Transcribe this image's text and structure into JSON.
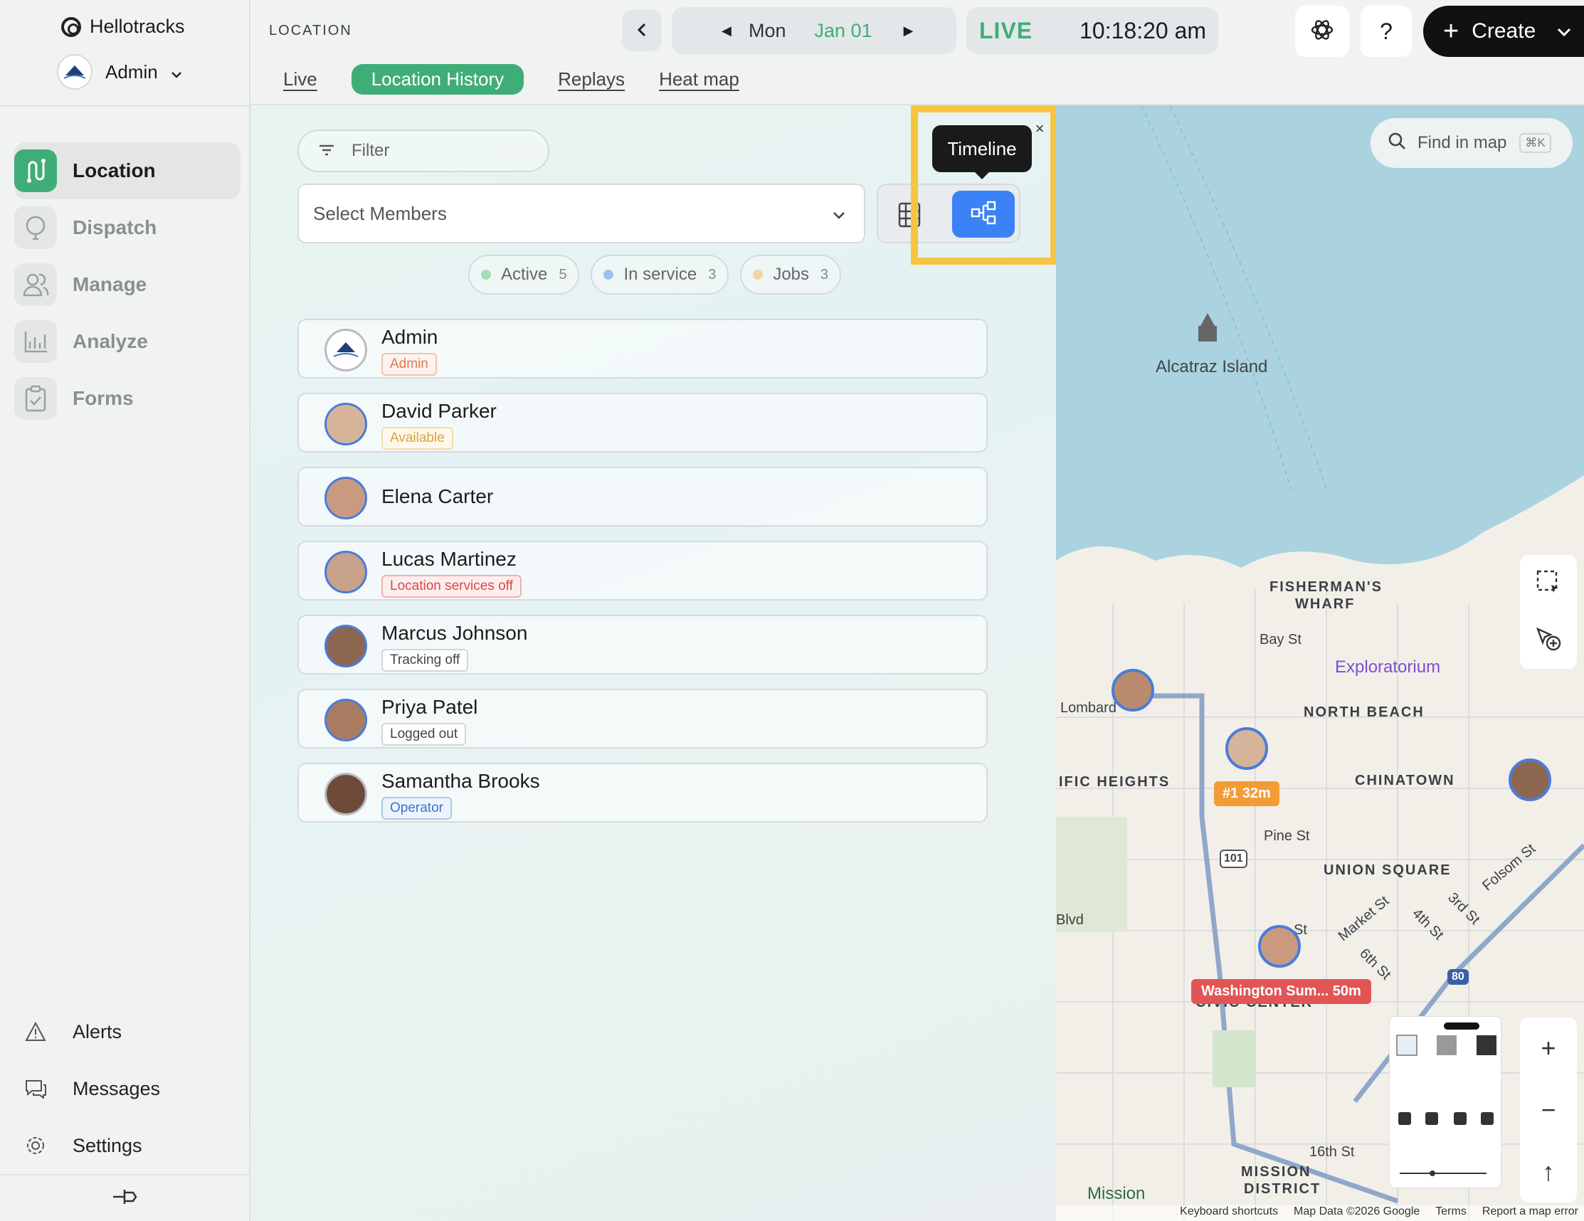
{
  "app": {
    "name": "Hellotracks",
    "account": "Admin"
  },
  "sidebar": {
    "items": [
      {
        "label": "Location",
        "active": true
      },
      {
        "label": "Dispatch"
      },
      {
        "label": "Manage"
      },
      {
        "label": "Analyze"
      },
      {
        "label": "Forms"
      }
    ],
    "bottom": [
      {
        "label": "Alerts"
      },
      {
        "label": "Messages"
      },
      {
        "label": "Settings"
      }
    ]
  },
  "header": {
    "page_label": "LOCATION",
    "date": {
      "day": "Mon",
      "date": "Jan 01"
    },
    "live_label": "LIVE",
    "time": "10:18:20 am",
    "help": "?",
    "create": "Create",
    "tabs": [
      {
        "label": "Live"
      },
      {
        "label": "Location History",
        "active": true
      },
      {
        "label": "Replays"
      },
      {
        "label": "Heat map"
      }
    ]
  },
  "panel": {
    "filter_placeholder": "Filter",
    "select_placeholder": "Select Members",
    "tooltip": "Timeline",
    "chips": [
      {
        "label": "Active",
        "count": "5",
        "color": "#a8dcb6"
      },
      {
        "label": "In service",
        "count": "3",
        "color": "#9cc2f0"
      },
      {
        "label": "Jobs",
        "count": "3",
        "color": "#f2d49e"
      }
    ],
    "members": [
      {
        "name": "Admin",
        "tag": "Admin",
        "tag_color": "#e07a4f"
      },
      {
        "name": "David Parker",
        "tag": "Available",
        "tag_color": "#e0a23a"
      },
      {
        "name": "Elena Carter",
        "tag": ""
      },
      {
        "name": "Lucas Martinez",
        "tag": "Location services off",
        "tag_color": "#d94848"
      },
      {
        "name": "Marcus Johnson",
        "tag": "Tracking off",
        "tag_color": "#444444"
      },
      {
        "name": "Priya Patel",
        "tag": "Logged out",
        "tag_color": "#444444"
      },
      {
        "name": "Samantha Brooks",
        "tag": "Operator",
        "tag_color": "#3a74c9"
      }
    ]
  },
  "map": {
    "find_placeholder": "Find in map",
    "find_shortcut": "⌘K",
    "labels": {
      "alcatraz": "Alcatraz Island",
      "fishermans_1": "FISHERMAN'S",
      "fishermans_2": "WHARF",
      "bay_st": "Bay St",
      "exploratorium": "Exploratorium",
      "north_beach": "NORTH BEACH",
      "lombard": "Lombard",
      "pacific_heights": "IFIC HEIGHTS",
      "chinatown": "CHINATOWN",
      "pine_st": "Pine St",
      "union_square": "UNION SQUARE",
      "hwy_101": "101",
      "market_st": "Market St",
      "st_4th": "4th St",
      "st_3rd": "3rd St",
      "folsom_st": "Folsom St",
      "st_6th": "6th St",
      "blvd": "Blvd",
      "st": "St",
      "civic_center": "CIVIC CENTER",
      "hwy_80": "80",
      "st_16th": "16th St",
      "mission": "Mission",
      "mission_district_1": "MISSION",
      "mission_district_2": "DISTRICT"
    },
    "badges": {
      "orange": "#1 32m",
      "red": "Washington Sum... 50m"
    },
    "zoom": {
      "in": "+",
      "out": "−",
      "reset": "↑"
    },
    "attribution": [
      "Keyboard shortcuts",
      "Map Data ©2026 Google",
      "Terms",
      "Report a map error"
    ]
  }
}
